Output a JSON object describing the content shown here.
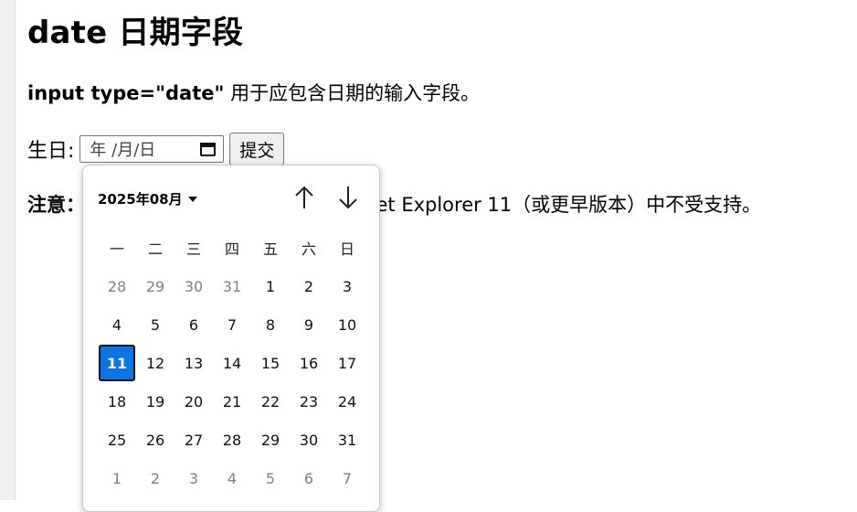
{
  "page": {
    "heading": "date 日期字段",
    "paragraph_bold": "input type=\"date\"",
    "paragraph_rest": " 用于应包含日期的输入字段。",
    "note_bold": "注意：",
    "note_rest": "ernet Explorer 11（或更早版本）中不受支持。"
  },
  "form": {
    "label": "生日:",
    "date_placeholder": "年 /月/日",
    "submit_label": "提交"
  },
  "picker": {
    "month_label": "2025年08月",
    "weekdays": [
      "一",
      "二",
      "三",
      "四",
      "五",
      "六",
      "日"
    ],
    "days": [
      {
        "d": "28",
        "muted": true
      },
      {
        "d": "29",
        "muted": true
      },
      {
        "d": "30",
        "muted": true
      },
      {
        "d": "31",
        "muted": true
      },
      {
        "d": "1"
      },
      {
        "d": "2"
      },
      {
        "d": "3"
      },
      {
        "d": "4"
      },
      {
        "d": "5"
      },
      {
        "d": "6"
      },
      {
        "d": "7"
      },
      {
        "d": "8"
      },
      {
        "d": "9"
      },
      {
        "d": "10"
      },
      {
        "d": "11",
        "selected": true
      },
      {
        "d": "12"
      },
      {
        "d": "13"
      },
      {
        "d": "14"
      },
      {
        "d": "15"
      },
      {
        "d": "16"
      },
      {
        "d": "17"
      },
      {
        "d": "18"
      },
      {
        "d": "19"
      },
      {
        "d": "20"
      },
      {
        "d": "21"
      },
      {
        "d": "22"
      },
      {
        "d": "23"
      },
      {
        "d": "24"
      },
      {
        "d": "25"
      },
      {
        "d": "26"
      },
      {
        "d": "27"
      },
      {
        "d": "28"
      },
      {
        "d": "29"
      },
      {
        "d": "30"
      },
      {
        "d": "31"
      },
      {
        "d": "1",
        "muted": true
      },
      {
        "d": "2",
        "muted": true
      },
      {
        "d": "3",
        "muted": true
      },
      {
        "d": "4",
        "muted": true
      },
      {
        "d": "5",
        "muted": true
      },
      {
        "d": "6",
        "muted": true
      },
      {
        "d": "7",
        "muted": true
      }
    ],
    "selected_color": "#0a74e8"
  }
}
